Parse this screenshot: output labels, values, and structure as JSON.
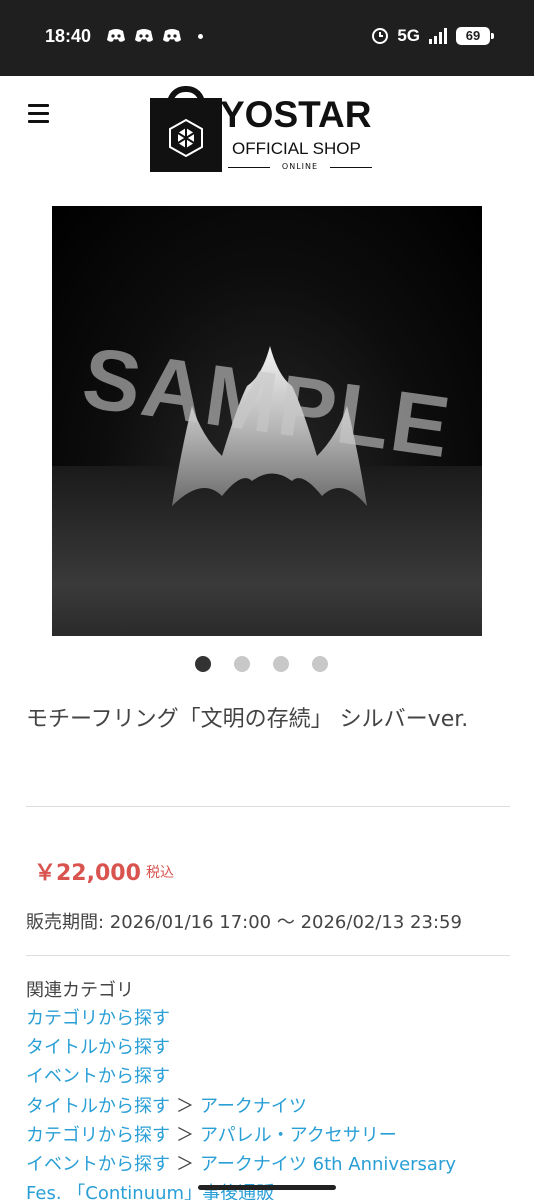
{
  "status_bar": {
    "time": "18:40",
    "network": "5G",
    "battery": "69",
    "left_icons": [
      "discord-icon",
      "discord-icon",
      "discord-icon"
    ]
  },
  "header": {
    "menu_icon": "hamburger-menu-icon",
    "logo": {
      "word": "YOSTAR",
      "sub": "OFFICIAL SHOP",
      "online": "ONLINE"
    }
  },
  "gallery": {
    "watermark": "SAMPLE",
    "slides": 4,
    "active_slide": 1
  },
  "product": {
    "title": "モチーフリング「文明の存続」 シルバーver.",
    "price": "￥22,000",
    "tax_label": "税込",
    "sale_period": "販売期間: 2026/01/16 17:00 ～ 2026/02/13 23:59"
  },
  "related": {
    "heading": "関連カテゴリ",
    "separator": "＞",
    "links": [
      {
        "parts": [
          "カテゴリから探す"
        ]
      },
      {
        "parts": [
          "タイトルから探す"
        ]
      },
      {
        "parts": [
          "イベントから探す"
        ]
      },
      {
        "parts": [
          "タイトルから探す",
          "アークナイツ"
        ]
      },
      {
        "parts": [
          "カテゴリから探す",
          "アパレル・アクセサリー"
        ]
      },
      {
        "parts": [
          "イベントから探す",
          "アークナイツ 6th Anniversary"
        ]
      }
    ],
    "cut_line": "Fes. 「Continuum」事後通販"
  },
  "colors": {
    "link": "#2a9fd6",
    "price": "#d9534f",
    "status_bar": "#1f1f1f"
  }
}
